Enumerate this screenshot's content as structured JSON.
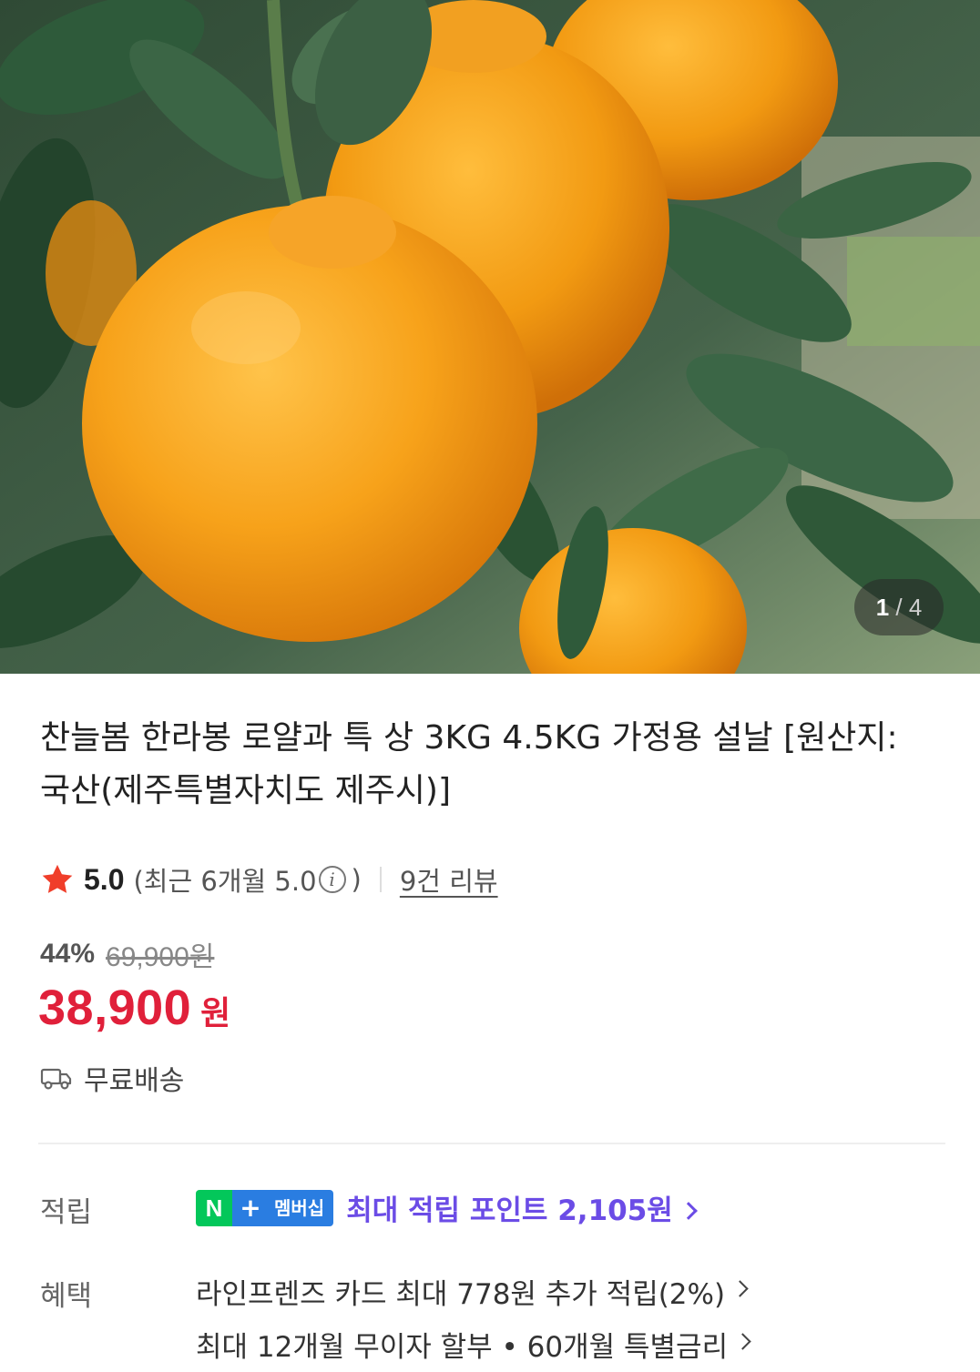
{
  "gallery": {
    "current": "1",
    "total": "4",
    "image_subject": "hallabong-oranges-on-tree"
  },
  "product": {
    "title": "찬늘봄 한라봉 로얄과 특 상 3KG 4.5KG 가정용 설날 [원산지:국산(제주특별자치도 제주시)]"
  },
  "rating": {
    "score": "5.0",
    "recent_prefix": "(최근 6개월 5.0",
    "recent_suffix": ")",
    "review_link": "9건 리뷰",
    "star_color": "#f03e2a"
  },
  "price": {
    "discount": "44%",
    "original": "69,900원",
    "sale": "38,900",
    "currency": "원",
    "sale_color": "#e0203a"
  },
  "shipping": {
    "label": "무료배송",
    "icon": "truck-icon"
  },
  "points": {
    "label": "적립",
    "badge_n": "N",
    "badge_plus": "+",
    "badge_text": "멤버십",
    "text": "최대 적립 포인트 2,105원",
    "color": "#6b4ce6"
  },
  "benefits": {
    "label": "혜택",
    "items": [
      "라인프렌즈 카드 최대 778원 추가 적립(2%)",
      "최대 12개월 무이자 할부 • 60개월 특별금리"
    ]
  }
}
